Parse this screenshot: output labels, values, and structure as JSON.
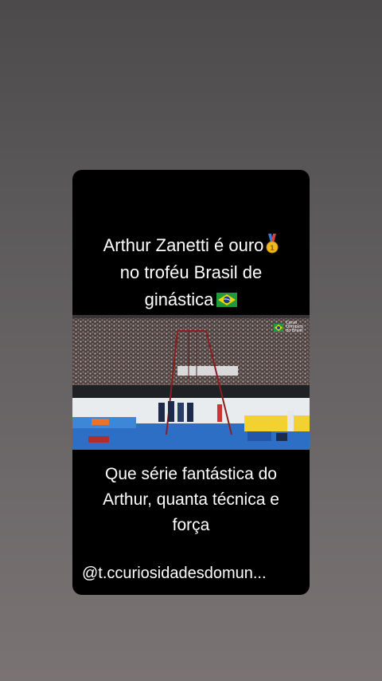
{
  "post": {
    "title_lines": [
      "Arthur Zanetti é ouro",
      "no troféu Brasil de",
      "ginástica"
    ],
    "title_medal_icon": "gold-medal-icon",
    "title_flag_icon": "brazil-flag-icon",
    "video": {
      "broadcaster_logo_lines": [
        "Canal",
        "Olímpico",
        "do Brasil"
      ]
    },
    "caption_lines": [
      "Que série fantástica do",
      "Arthur, quanta técnica e",
      "força"
    ],
    "handle": "@t.ccuriosidadesdomun..."
  },
  "colors": {
    "background_top": "#4c4a4b",
    "background_bottom": "#7a7374",
    "card": "#000000",
    "text": "#ffffff",
    "flag_green": "#1f9a3c",
    "flag_yellow": "#f6d400",
    "flag_blue": "#1a3f8f",
    "medal_gold": "#f0b91e",
    "medal_ribbon": "#3b7bd8"
  }
}
